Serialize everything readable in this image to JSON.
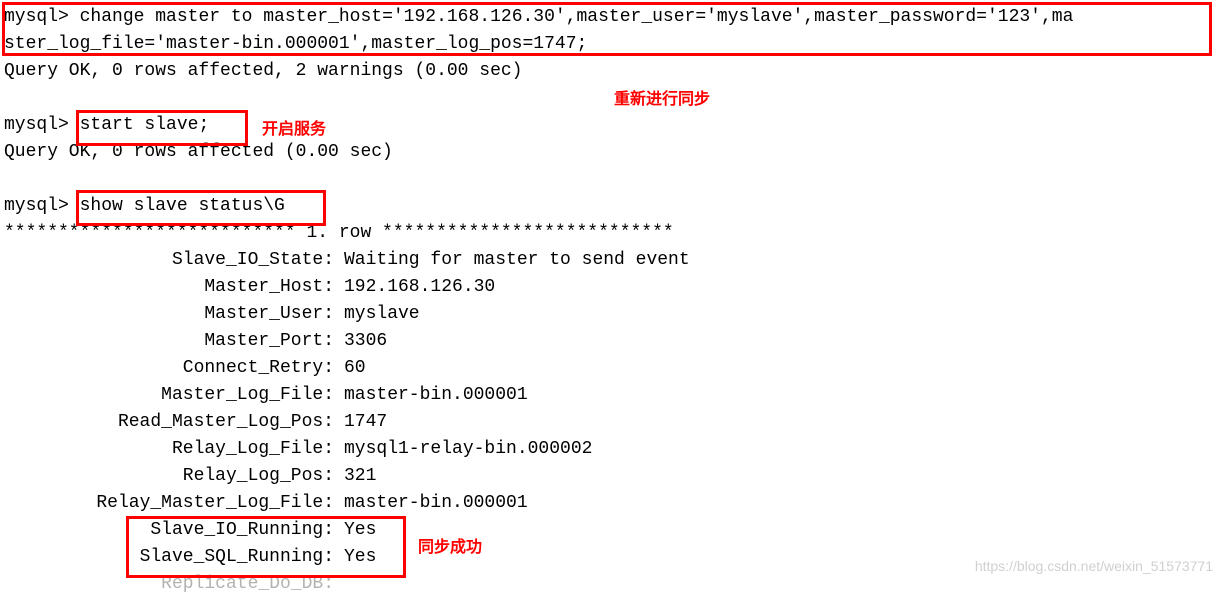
{
  "prompt": "mysql>",
  "cmd1_line1": "change master to master_host='192.168.126.30',master_user='myslave',master_password='123',ma",
  "cmd1_line2": "ster_log_file='master-bin.000001',master_log_pos=1747;",
  "result1": "Query OK, 0 rows affected, 2 warnings (0.00 sec)",
  "cmd2": "start slave;",
  "result2": "Query OK, 0 rows affected (0.00 sec)",
  "cmd3": "show slave status\\G",
  "row_header": "*************************** 1. row ***************************",
  "fields": [
    {
      "label": "Slave_IO_State:",
      "value": "Waiting for master to send event"
    },
    {
      "label": "Master_Host:",
      "value": "192.168.126.30"
    },
    {
      "label": "Master_User:",
      "value": "myslave"
    },
    {
      "label": "Master_Port:",
      "value": "3306"
    },
    {
      "label": "Connect_Retry:",
      "value": "60"
    },
    {
      "label": "Master_Log_File:",
      "value": "master-bin.000001"
    },
    {
      "label": "Read_Master_Log_Pos:",
      "value": "1747"
    },
    {
      "label": "Relay_Log_File:",
      "value": "mysql1-relay-bin.000002"
    },
    {
      "label": "Relay_Log_Pos:",
      "value": "321"
    },
    {
      "label": "Relay_Master_Log_File:",
      "value": "master-bin.000001"
    },
    {
      "label": "Slave_IO_Running:",
      "value": "Yes"
    },
    {
      "label": "Slave_SQL_Running:",
      "value": "Yes"
    }
  ],
  "truncated_field": "Replicate_Do_DB:",
  "annotations": {
    "resync": "重新进行同步",
    "start_service": "开启服务",
    "sync_success": "同步成功"
  },
  "watermark": "https://blog.csdn.net/weixin_51573771"
}
